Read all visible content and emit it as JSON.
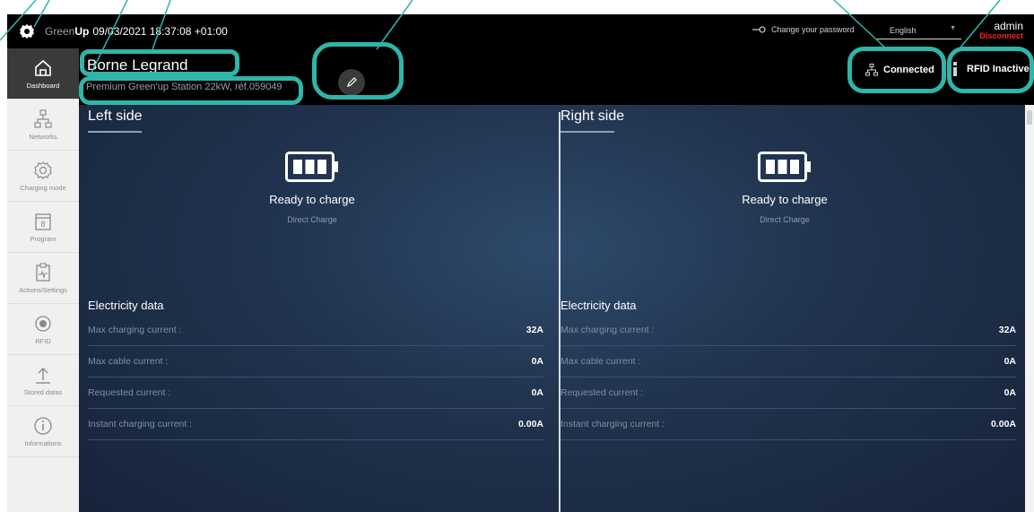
{
  "topbar": {
    "brand_prefix": "Green",
    "brand_suffix": "Up",
    "datetime": "09/03/2021 18:37:08 +01:00",
    "change_password": "Change your password",
    "language": "English",
    "user": "admin",
    "disconnect": "Disconnect"
  },
  "sidebar": {
    "items": [
      {
        "label": "Dashboard",
        "icon": "home-icon"
      },
      {
        "label": "Networks",
        "icon": "network-icon"
      },
      {
        "label": "Charging mode",
        "icon": "gear-icon"
      },
      {
        "label": "Program",
        "icon": "calendar-icon"
      },
      {
        "label": "Actions/Settings",
        "icon": "clipboard-icon"
      },
      {
        "label": "RFID",
        "icon": "rfid-icon"
      },
      {
        "label": "Stored datas",
        "icon": "upload-icon"
      },
      {
        "label": "Informations",
        "icon": "info-icon"
      }
    ]
  },
  "header": {
    "station_name": "Borne Legrand",
    "station_subtitle": "Premium Green'up Station 22kW, réf.059049",
    "connection_status": "Connected",
    "rfid_status": "RFID Inactive"
  },
  "left": {
    "title": "Left side",
    "status": "Ready to charge",
    "mode": "Direct Charge",
    "electricity_title": "Electricity data",
    "rows": [
      {
        "label": "Max charging current :",
        "value": "32A"
      },
      {
        "label": "Max cable current :",
        "value": "0A"
      },
      {
        "label": "Requested current :",
        "value": "0A"
      },
      {
        "label": "Instant charging current :",
        "value": "0.00A"
      }
    ]
  },
  "right": {
    "title": "Right side",
    "status": "Ready to charge",
    "mode": "Direct Charge",
    "electricity_title": "Electricity data",
    "rows": [
      {
        "label": "Max charging current :",
        "value": "32A"
      },
      {
        "label": "Max cable current :",
        "value": "0A"
      },
      {
        "label": "Requested current :",
        "value": "0A"
      },
      {
        "label": "Instant charging current :",
        "value": "0.00A"
      }
    ]
  },
  "colors": {
    "callout": "#2fb5aa",
    "disconnect": "#ff1f1f",
    "panel_bg": "#20324d"
  }
}
